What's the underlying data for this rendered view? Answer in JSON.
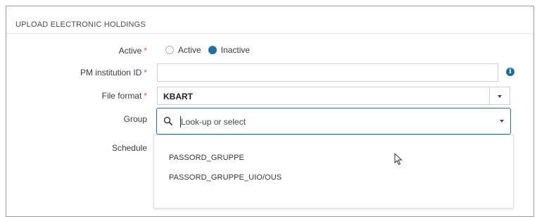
{
  "section": {
    "title": "UPLOAD ELECTRONIC HOLDINGS"
  },
  "form": {
    "active": {
      "label": "Active",
      "required_mark": "*",
      "options": [
        "Active",
        "Inactive"
      ],
      "selected": "Inactive"
    },
    "pm_institution_id": {
      "label": "PM institution ID",
      "required_mark": "*",
      "value": ""
    },
    "file_format": {
      "label": "File format",
      "required_mark": "*",
      "value": "KBART"
    },
    "group": {
      "label": "Group",
      "placeholder": "Look-up or select",
      "options": [
        "PASSORD_GRUPPE",
        "PASSORD_GRUPPE_UIO/OUS"
      ]
    },
    "schedule": {
      "label": "Schedule"
    }
  },
  "icons": {
    "info": "info-icon",
    "search": "search-icon",
    "dropdown": "chevron-down-icon"
  },
  "colors": {
    "accent": "#1d6fa5",
    "required": "#d9534f"
  }
}
